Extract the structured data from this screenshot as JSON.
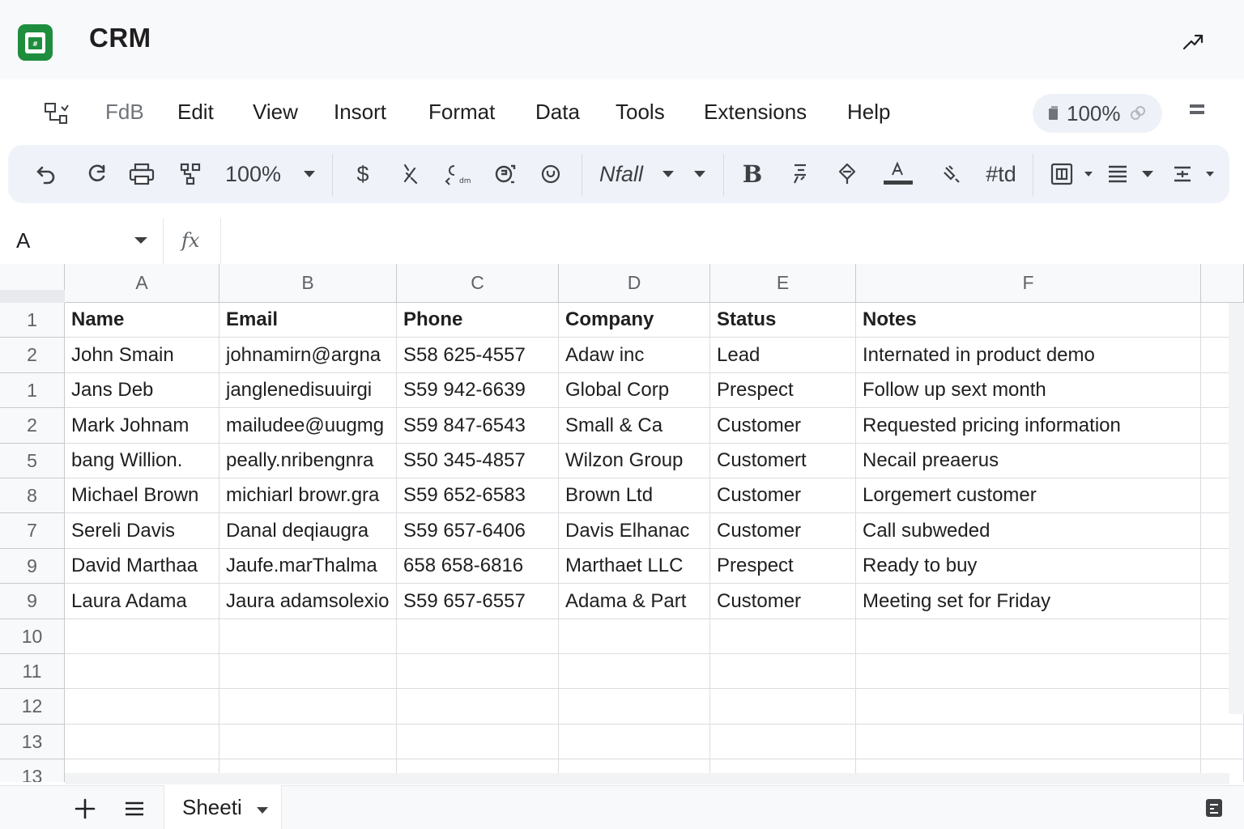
{
  "app": {
    "title": "CRM",
    "brand_color": "#188038"
  },
  "menu": {
    "items": [
      {
        "label": "FdB",
        "dim": true
      },
      {
        "label": "Edit"
      },
      {
        "label": "View"
      },
      {
        "label": "Insort"
      },
      {
        "label": "Format"
      },
      {
        "label": "Data"
      },
      {
        "label": "Tools"
      },
      {
        "label": "Extensions"
      },
      {
        "label": "Help"
      }
    ],
    "zoom_label": "100%"
  },
  "toolbar": {
    "zoom_value": "100%",
    "currency_label": "$",
    "font_label": "Nfall",
    "bold_label": "B",
    "number_format_label": "#td"
  },
  "formula_bar": {
    "name_box": "A",
    "fx_label": "fx",
    "value": ""
  },
  "sheet": {
    "columns": [
      "A",
      "B",
      "C",
      "D",
      "E",
      "F"
    ],
    "row_labels": [
      "1",
      "2",
      "1",
      "2",
      "5",
      "8",
      "7",
      "9",
      "9",
      "10",
      "11",
      "12",
      "13",
      "13"
    ],
    "rows": [
      [
        "Name",
        "Email",
        "Phone",
        "Company",
        "Status",
        "Notes"
      ],
      [
        "John Smain",
        "johnamirn@argna",
        "S58 625-4557",
        "Adaw inc",
        "Lead",
        "Internated in product demo"
      ],
      [
        "Jans Deb",
        "janglenedisuuirgi",
        "S59 942-6639",
        "Global Corp",
        "Prespect",
        "Follow up sext month"
      ],
      [
        "Mark Johnam",
        "mailudee@uugmg",
        "S59 847-6543",
        "Small & Ca",
        "Customer",
        "Requested pricing information"
      ],
      [
        "bang Willion.",
        "peally.nribengnra",
        "S50 345-4857",
        "Wilzon Group",
        "Customert",
        "Necail preaerus"
      ],
      [
        "Michael Brown",
        "michiarl browr.gra",
        "S59 652-6583",
        "Brown Ltd",
        "Customer",
        "Lorgemert customer"
      ],
      [
        "Sereli Davis",
        "Danal deqiaugra",
        "S59 657-6406",
        "Davis Elhanac",
        "Customer",
        "Call subweded"
      ],
      [
        "David Marthaa",
        "Jaufe.marThalma",
        "658 658-6816",
        "Marthaet LLC",
        "Prespect",
        "Ready to buy"
      ],
      [
        "Laura Adama",
        "Jaura adamsolexio",
        "S59 657-6557",
        "Adama & Part",
        "Customer",
        "Meeting set for Friday"
      ]
    ],
    "tab_name": "Sheeti"
  }
}
